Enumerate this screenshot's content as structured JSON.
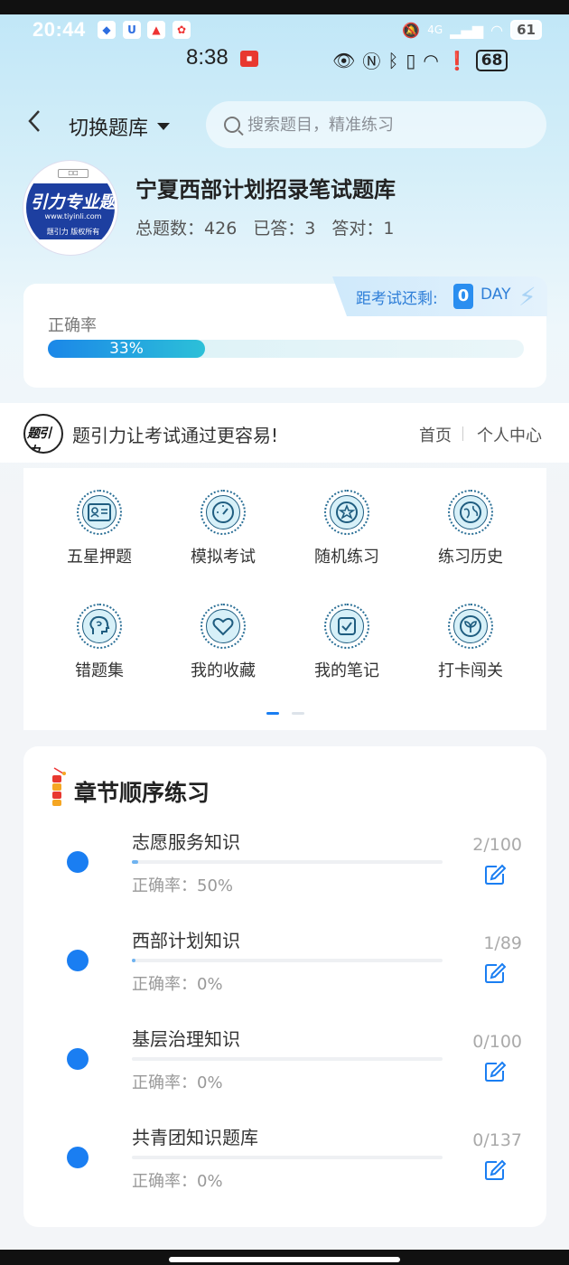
{
  "status_bar": {
    "time": "20:44",
    "signal_label": "4G",
    "battery": "61"
  },
  "status_bar_inner": {
    "time": "8:38",
    "battery": "68"
  },
  "header": {
    "back_icon": "chevron-left-icon",
    "switch_label": "切换题库",
    "search_placeholder": "搜索题目，精准练习"
  },
  "bank": {
    "logo_text": "引力专业题",
    "logo_url": "www.tiyinli.com",
    "logo_copyright": "题引力 版权所有",
    "title": "宁夏西部计划招录笔试题库",
    "total_label": "总题数：",
    "total": "426",
    "answered_label": "已答：",
    "answered": "3",
    "correct_label": "答对：",
    "correct": "1"
  },
  "accuracy": {
    "label": "正确率",
    "percent_text": "33%",
    "percent_value": 0.33,
    "countdown_label": "距考试还剩:",
    "countdown_days": "0",
    "countdown_unit": "DAY"
  },
  "slogan": {
    "text": "题引力让考试通过更容易!",
    "nav_home": "首页",
    "nav_user": "个人中心"
  },
  "menu": {
    "items": [
      {
        "label": "五星押题",
        "icon": "id-card-icon"
      },
      {
        "label": "模拟考试",
        "icon": "gauge-icon"
      },
      {
        "label": "随机练习",
        "icon": "random-star-icon"
      },
      {
        "label": "练习历史",
        "icon": "globe-icon"
      },
      {
        "label": "错题集",
        "icon": "head-icon"
      },
      {
        "label": "我的收藏",
        "icon": "heart-icon"
      },
      {
        "label": "我的笔记",
        "icon": "note-check-icon"
      },
      {
        "label": "打卡闯关",
        "icon": "sprout-icon"
      }
    ],
    "active_page": 1,
    "page_count": 2
  },
  "chapters": {
    "title": "章节顺序练习",
    "items": [
      {
        "name": "志愿服务知识",
        "accuracy": "正确率：50%",
        "count": "2/100",
        "progress": 0.02
      },
      {
        "name": "西部计划知识",
        "accuracy": "正确率：0%",
        "count": "1/89",
        "progress": 0.011
      },
      {
        "name": "基层治理知识",
        "accuracy": "正确率：0%",
        "count": "0/100",
        "progress": 0
      },
      {
        "name": "共青团知识题库",
        "accuracy": "正确率：0%",
        "count": "0/137",
        "progress": 0
      }
    ]
  },
  "colors": {
    "accent": "#1a7ef2",
    "progress_start": "#1b87e8",
    "progress_end": "#2cc0d8"
  }
}
